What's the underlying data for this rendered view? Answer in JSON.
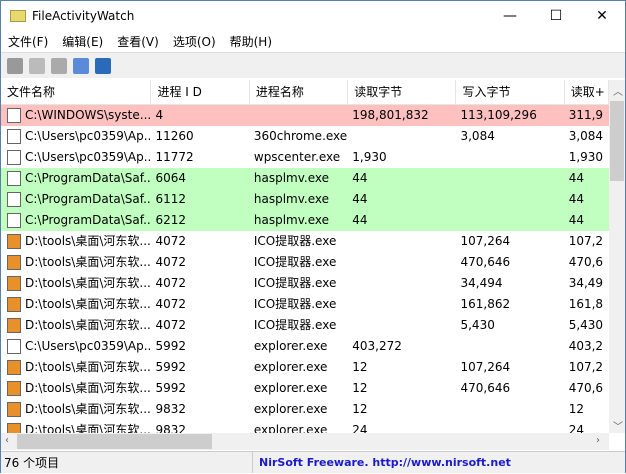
{
  "window": {
    "title": "FileActivityWatch"
  },
  "menu": [
    "文件(F)",
    "编辑(E)",
    "查看(V)",
    "选项(O)",
    "帮助(H)"
  ],
  "columns": [
    "文件名称",
    "进程 I D",
    "进程名称",
    "读取字节",
    "写入字节",
    "读取+"
  ],
  "colors": {
    "red_row": "#ffc0c0",
    "green_row": "#c0ffc0"
  },
  "rows": [
    {
      "file": "C:\\WINDOWS\\syste...",
      "pid": "4",
      "proc": "",
      "read": "198,801,832",
      "write": "113,109,296",
      "total": "311,9",
      "hl": "red"
    },
    {
      "file": "C:\\Users\\pc0359\\Ap...",
      "pid": "11260",
      "proc": "360chrome.exe",
      "read": "",
      "write": "3,084",
      "total": "3,084",
      "hl": ""
    },
    {
      "file": "C:\\Users\\pc0359\\Ap...",
      "pid": "11772",
      "proc": "wpscenter.exe",
      "read": "1,930",
      "write": "",
      "total": "1,930",
      "hl": ""
    },
    {
      "file": "C:\\ProgramData\\Saf...",
      "pid": "6064",
      "proc": "hasplmv.exe",
      "read": "44",
      "write": "",
      "total": "44",
      "hl": "green"
    },
    {
      "file": "C:\\ProgramData\\Saf...",
      "pid": "6112",
      "proc": "hasplmv.exe",
      "read": "44",
      "write": "",
      "total": "44",
      "hl": "green"
    },
    {
      "file": "C:\\ProgramData\\Saf...",
      "pid": "6212",
      "proc": "hasplmv.exe",
      "read": "44",
      "write": "",
      "total": "44",
      "hl": "green"
    },
    {
      "file": "D:\\tools\\桌面\\河东软...",
      "pid": "4072",
      "proc": "ICO提取器.exe",
      "read": "",
      "write": "107,264",
      "total": "107,2",
      "hl": ""
    },
    {
      "file": "D:\\tools\\桌面\\河东软...",
      "pid": "4072",
      "proc": "ICO提取器.exe",
      "read": "",
      "write": "470,646",
      "total": "470,6",
      "hl": ""
    },
    {
      "file": "D:\\tools\\桌面\\河东软...",
      "pid": "4072",
      "proc": "ICO提取器.exe",
      "read": "",
      "write": "34,494",
      "total": "34,49",
      "hl": ""
    },
    {
      "file": "D:\\tools\\桌面\\河东软...",
      "pid": "4072",
      "proc": "ICO提取器.exe",
      "read": "",
      "write": "161,862",
      "total": "161,8",
      "hl": ""
    },
    {
      "file": "D:\\tools\\桌面\\河东软...",
      "pid": "4072",
      "proc": "ICO提取器.exe",
      "read": "",
      "write": "5,430",
      "total": "5,430",
      "hl": ""
    },
    {
      "file": "C:\\Users\\pc0359\\Ap...",
      "pid": "5992",
      "proc": "explorer.exe",
      "read": "403,272",
      "write": "",
      "total": "403,2",
      "hl": ""
    },
    {
      "file": "D:\\tools\\桌面\\河东软...",
      "pid": "5992",
      "proc": "explorer.exe",
      "read": "12",
      "write": "107,264",
      "total": "107,2",
      "hl": ""
    },
    {
      "file": "D:\\tools\\桌面\\河东软...",
      "pid": "5992",
      "proc": "explorer.exe",
      "read": "12",
      "write": "470,646",
      "total": "470,6",
      "hl": ""
    },
    {
      "file": "D:\\tools\\桌面\\河东软...",
      "pid": "9832",
      "proc": "explorer.exe",
      "read": "12",
      "write": "",
      "total": "12",
      "hl": ""
    },
    {
      "file": "D:\\tools\\桌面\\河东软...",
      "pid": "9832",
      "proc": "explorer.exe",
      "read": "24",
      "write": "",
      "total": "24",
      "hl": ""
    }
  ],
  "status": {
    "count": "76 个项目",
    "credit": "NirSoft Freeware.  http://www.nirsoft.net"
  }
}
